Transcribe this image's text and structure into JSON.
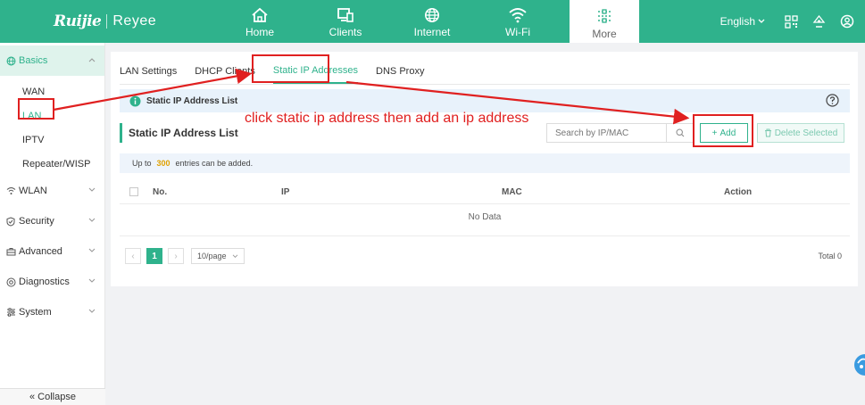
{
  "brand": {
    "logo_primary": "Ruijie",
    "logo_secondary": "Reyee"
  },
  "colors": {
    "brand": "#2fb28c",
    "annotation": "#e02020",
    "info_bg": "#e8f2fb",
    "limit_num": "#e0a100"
  },
  "nav": {
    "items": [
      {
        "label": "Home",
        "icon": "home-icon"
      },
      {
        "label": "Clients",
        "icon": "monitor-icon"
      },
      {
        "label": "Internet",
        "icon": "globe-icon"
      },
      {
        "label": "Wi-Fi",
        "icon": "wifi-icon"
      },
      {
        "label": "More",
        "icon": "sliders-icon",
        "active": true
      }
    ],
    "language": "English",
    "tools": [
      "qr-code-icon",
      "tree-icon",
      "user-icon"
    ]
  },
  "sidebar": {
    "groups": [
      {
        "label": "Basics",
        "icon": "globe-icon",
        "active": true,
        "items": [
          "WAN",
          "LAN",
          "IPTV",
          "Repeater/WISP"
        ],
        "active_item": "LAN"
      },
      {
        "label": "WLAN",
        "icon": "wifi-icon"
      },
      {
        "label": "Security",
        "icon": "shield-icon"
      },
      {
        "label": "Advanced",
        "icon": "toolbox-icon"
      },
      {
        "label": "Diagnostics",
        "icon": "diagnostics-icon"
      },
      {
        "label": "System",
        "icon": "settings-icon"
      }
    ],
    "collapse_label": "Collapse"
  },
  "main": {
    "tabs": [
      "LAN Settings",
      "DHCP Clients",
      "Static IP Addresses",
      "DNS Proxy"
    ],
    "active_tab": "Static IP Addresses",
    "info_title": "Static IP Address List",
    "section_title": "Static IP Address List",
    "search_placeholder": "Search by IP/MAC",
    "add_label": "Add",
    "delete_label": "Delete Selected",
    "limit_prefix": "Up to",
    "limit_value": "300",
    "limit_suffix": "entries can be added.",
    "columns": [
      "No.",
      "IP",
      "MAC",
      "Action"
    ],
    "no_data": "No Data",
    "pagination": {
      "current_page": "1",
      "page_size": "10/page",
      "total": "Total 0"
    }
  },
  "annotation": {
    "text": "click static ip address then add an ip address"
  }
}
